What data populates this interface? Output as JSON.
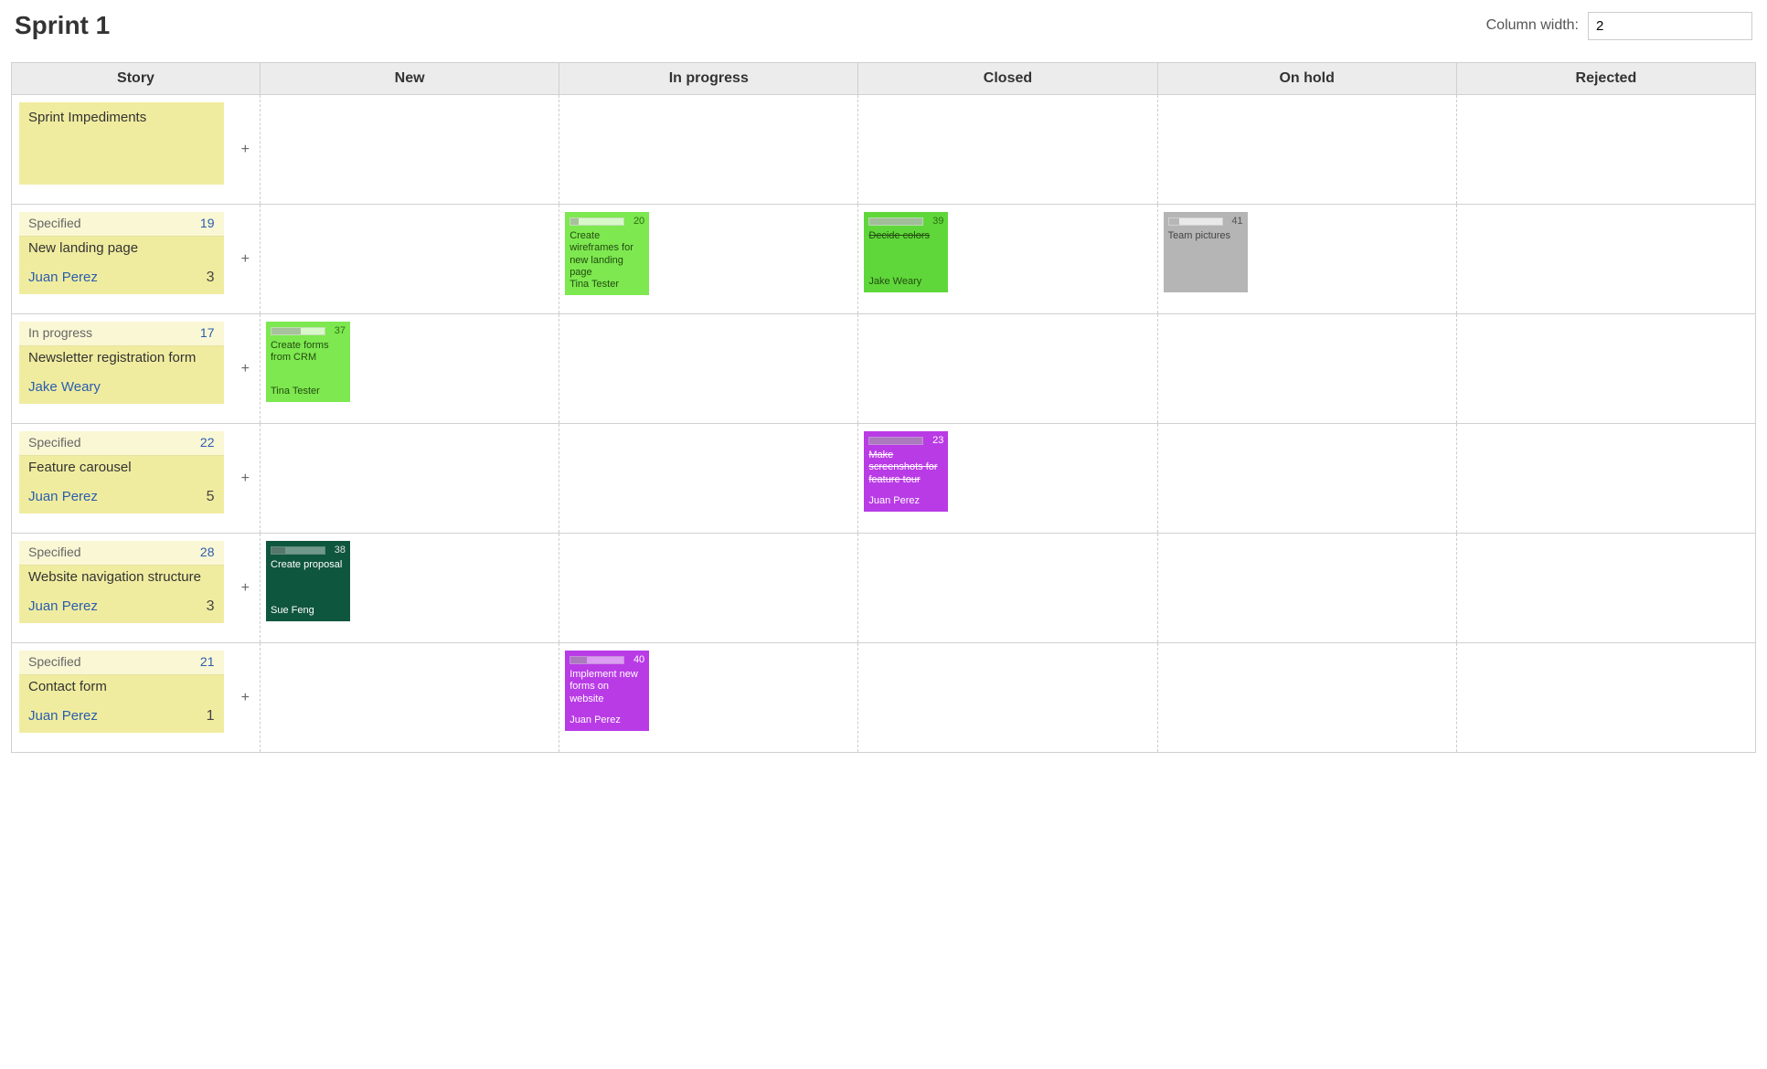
{
  "header": {
    "title": "Sprint 1",
    "column_width_label": "Column width:",
    "column_width_value": "2"
  },
  "columns": {
    "story": "Story",
    "new": "New",
    "in_progress": "In progress",
    "closed": "Closed",
    "on_hold": "On hold",
    "rejected": "Rejected"
  },
  "add_icon": "+",
  "rows": [
    {
      "story": {
        "title": "Sprint Impediments"
      }
    },
    {
      "story": {
        "status": "Specified",
        "id": "19",
        "title": "New landing page",
        "owner": "Juan Perez",
        "points": "3"
      },
      "in_progress": [
        {
          "id": "20",
          "title": "Create wireframes for new landing page",
          "owner": "Tina Tester",
          "color": "lime",
          "progress": 15
        }
      ],
      "closed": [
        {
          "id": "39",
          "title": "Decide colors",
          "owner": "Jake Weary",
          "color": "green",
          "strike": true,
          "progress": 100
        }
      ],
      "on_hold": [
        {
          "id": "41",
          "title": "Team pictures",
          "owner": "",
          "color": "grey",
          "progress": 20
        }
      ]
    },
    {
      "story": {
        "status": "In progress",
        "id": "17",
        "title": "Newsletter registration form",
        "owner": "Jake Weary",
        "points": ""
      },
      "new": [
        {
          "id": "37",
          "title": "Create forms from CRM",
          "owner": "Tina Tester",
          "color": "lime",
          "progress": 55
        }
      ]
    },
    {
      "story": {
        "status": "Specified",
        "id": "22",
        "title": "Feature carousel",
        "owner": "Juan Perez",
        "points": "5"
      },
      "closed": [
        {
          "id": "23",
          "title": "Make screenshots for feature tour",
          "owner": "Juan Perez",
          "color": "purple",
          "strike": true,
          "progress": 100
        }
      ]
    },
    {
      "story": {
        "status": "Specified",
        "id": "28",
        "title": "Website navigation structure",
        "owner": "Juan Perez",
        "points": "3"
      },
      "new": [
        {
          "id": "38",
          "title": "Create proposal",
          "owner": "Sue Feng",
          "color": "teal",
          "progress": 25
        }
      ]
    },
    {
      "story": {
        "status": "Specified",
        "id": "21",
        "title": "Contact form",
        "owner": "Juan Perez",
        "points": "1"
      },
      "in_progress": [
        {
          "id": "40",
          "title": "Implement new forms on website",
          "owner": "Juan Perez",
          "color": "purple",
          "progress": 30
        }
      ]
    }
  ]
}
